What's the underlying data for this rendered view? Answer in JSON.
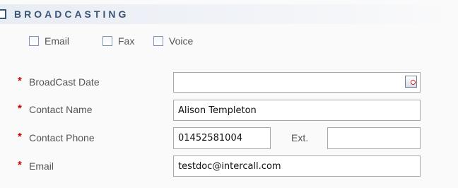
{
  "section": {
    "title": "BROADCASTING"
  },
  "channels": [
    {
      "label": "Email",
      "checked": false
    },
    {
      "label": "Fax",
      "checked": false
    },
    {
      "label": "Voice",
      "checked": false
    }
  ],
  "required_marker": "*",
  "fields": {
    "broadcast_date": {
      "label": "BroadCast Date",
      "value": ""
    },
    "contact_name": {
      "label": "Contact Name",
      "value": "Alison Templeton"
    },
    "contact_phone": {
      "label": "Contact Phone",
      "value": "01452581004"
    },
    "ext": {
      "label": "Ext.",
      "value": ""
    },
    "email": {
      "label": "Email",
      "value": "testdoc@intercall.com"
    }
  },
  "icons": {
    "collapse": "collapse-icon",
    "calendar": "calendar-icon"
  },
  "colors": {
    "header_text": "#3b5578",
    "required": "#cc0000",
    "label_text": "#555555"
  }
}
